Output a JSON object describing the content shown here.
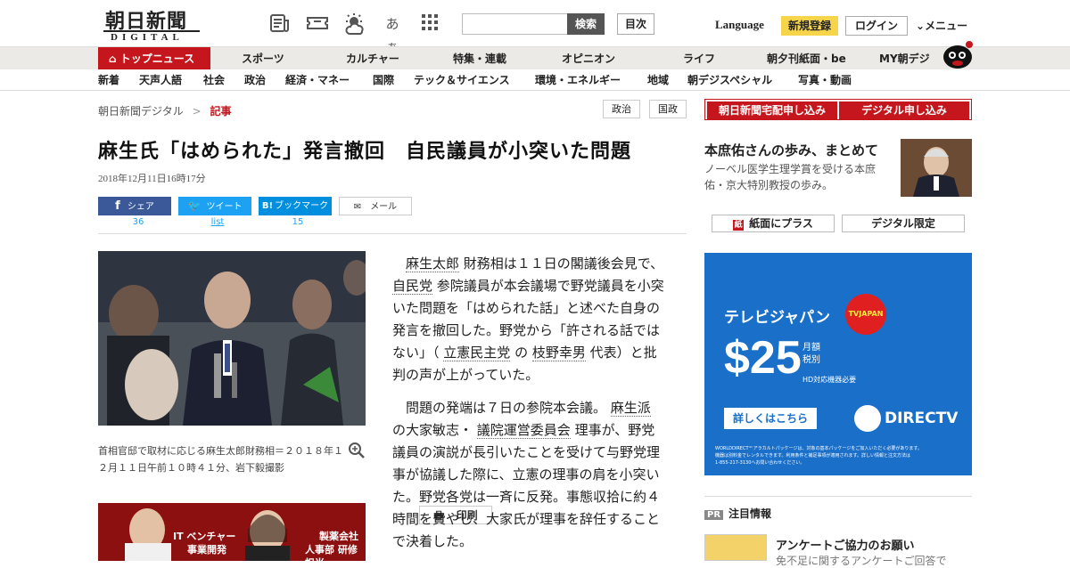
{
  "header": {
    "logo_jp": "朝日新聞",
    "logo_en": "DIGITAL",
    "aa_label": "あぁ",
    "search_button": "検索",
    "toc_button": "目次",
    "language": "Language",
    "register": "新規登録",
    "login": "ログイン",
    "menu": "メニュー"
  },
  "nav1": [
    "トップニュース",
    "スポーツ",
    "カルチャー",
    "特集・連載",
    "オピニオン",
    "ライフ",
    "朝夕刊紙面・be",
    "MY朝デジ"
  ],
  "nav2": [
    "新着",
    "天声人語",
    "社会",
    "政治",
    "経済・マネー",
    "国際",
    "テック＆サイエンス",
    "環境・エネルギー",
    "地域",
    "朝デジスペシャル",
    "写真・動画"
  ],
  "breadcrumb": {
    "home": "朝日新聞デジタル",
    "sep": ">",
    "current": "記事"
  },
  "tags": [
    "政治",
    "国政"
  ],
  "article": {
    "title": "麻生氏「はめられた」発言撤回　自民議員が小突いた問題",
    "date": "2018年12月11日16時17分",
    "share": {
      "facebook": "シェア",
      "twitter": "ツイート",
      "hatena": "ブックマーク",
      "mail": "メール",
      "print": "印刷"
    },
    "counts": {
      "facebook": "36",
      "twitter": "list",
      "hatena": "15"
    },
    "caption": "首相官邸で取材に応じる麻生太郎財務相＝２０１８年１２月１１日午前１０時４１分、岩下毅撮影",
    "p1": [
      "麻生太郎",
      " 財務相は１１日の閣議後会見で、 ",
      "自民党",
      " 参院議員が本会議場で野党議員を小突いた問題を「はめられた話」と述べた自身の発言を撤回した。野党から「許される話ではない」（ ",
      "立憲民主党",
      " の ",
      "枝野幸男",
      " 代表）と批判の声が上がっていた。"
    ],
    "p2": [
      "問題の発端は７日の参院本会議。 ",
      "麻生派",
      " の大家敏志・ ",
      "議院運営委員会",
      " 理事が、野党議員の演説が長引いたことを受けて与野党理事が協議した際に、立憲の理事の肩を小突いた。野党各党は一斉に反発。事態収拾に約４時間を費やし、大家氏が理事を辞任することで決着した。"
    ]
  },
  "left_ad": {
    "line1a": "IT ベンチャー",
    "line1b": "事業開発",
    "line2a": "製薬会社",
    "line2b": "人事部 研修担当"
  },
  "sidebar": {
    "btn_home": "朝日新聞宅配申し込み",
    "btn_digital": "デジタル申し込み",
    "feature_title": "本庶佑さんの歩み、まとめて",
    "feature_text": "ノーベル医学生理学賞を受ける本庶佑・京大特別教授の歩み。",
    "paper_plus": "紙面にプラス",
    "digital_only": "デジタル限定",
    "ad": {
      "brand": "テレビジャパン",
      "price": "$25",
      "price_note1": "月額",
      "price_note2": "税別",
      "device": "HD対応機器必要",
      "cta": "詳しくはこちら",
      "directv": "DIRECTV",
      "fine1": "WORLDDIRECT℠アラカルトパッケージは、対象の基本パッケージをご加入いただく必要があります。",
      "fine2": "機器は別料金でレンタルできます。利用条件と補足事項が適用されます。詳しい情報と注文方法は",
      "fine3": "1-855-217-3130へお問い合わせください。"
    },
    "pr_badge": "PR",
    "pr_label": "注目情報",
    "pr_title": "アンケートご協力のお願い",
    "pr_sub": "免不足に関するアンケートご回答で"
  }
}
